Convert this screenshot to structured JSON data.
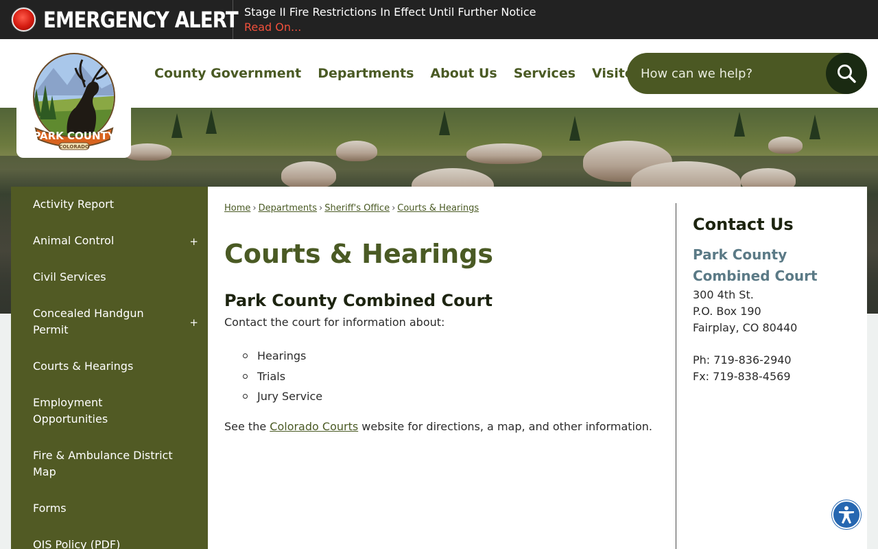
{
  "alert": {
    "title": "EMERGENCY ALERT",
    "message": "Stage II Fire Restrictions In Effect Until Further Notice",
    "link_text": "Read On..."
  },
  "logo": {
    "text": "PARK COUNTY",
    "subtext": "COLORADO"
  },
  "nav": {
    "items": [
      "County Government",
      "Departments",
      "About Us",
      "Services",
      "Visitors"
    ]
  },
  "search": {
    "placeholder": "How can we help?",
    "icon": "search-icon"
  },
  "sidebar": {
    "items": [
      {
        "label": "Activity Report",
        "expandable": false
      },
      {
        "label": "Animal Control",
        "expandable": true
      },
      {
        "label": "Civil Services",
        "expandable": false
      },
      {
        "label": "Concealed Handgun Permit",
        "expandable": true
      },
      {
        "label": "Courts & Hearings",
        "expandable": false
      },
      {
        "label": "Employment Opportunities",
        "expandable": false
      },
      {
        "label": "Fire & Ambulance District Map",
        "expandable": false
      },
      {
        "label": "Forms",
        "expandable": false
      },
      {
        "label": "OIS Policy (PDF)",
        "expandable": false
      }
    ],
    "expand_symbol": "+"
  },
  "breadcrumb": {
    "items": [
      "Home",
      "Departments",
      "Sheriff's Office",
      "Courts & Hearings"
    ],
    "separator": "›"
  },
  "main": {
    "title": "Courts & Hearings",
    "court_title": "Park County Combined Court",
    "intro": "Contact the court for information about:",
    "list": [
      "Hearings",
      "Trials",
      "Jury Service"
    ],
    "see_before": "See the ",
    "see_link": "Colorado Courts",
    "see_after": " website for directions, a map, and other information."
  },
  "contact": {
    "heading": "Contact Us",
    "org_line1": "Park County",
    "org_line2": "Combined Court",
    "address": [
      "300 4th St.",
      "P.O. Box 190",
      "Fairplay, CO 80440"
    ],
    "phone": "Ph: 719-836-2940",
    "fax": "Fx: 719-838-4569"
  },
  "accessibility": {
    "icon": "accessibility-icon"
  },
  "colors": {
    "alert_bg": "#222222",
    "alert_link": "#f0503c",
    "brand_green": "#4a5a24",
    "sidebar_bg": "#515a24",
    "search_btn": "#1a2a12",
    "contact_org": "#5b7a86",
    "access_blue": "#2667b1"
  }
}
